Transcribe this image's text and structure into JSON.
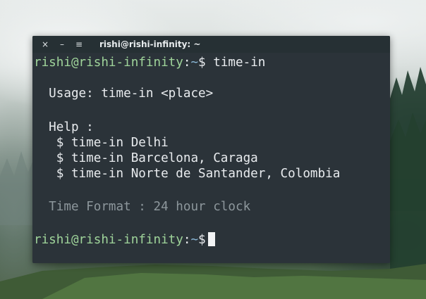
{
  "window": {
    "title": "rishi@rishi-infinity: ~",
    "buttons": {
      "close": "×",
      "minimize": "–",
      "menu": "≡"
    }
  },
  "terminal": {
    "prompt": {
      "user_host": "rishi@rishi-infinity",
      "separator": ":",
      "path": "~",
      "symbol": "$"
    },
    "command": " time-in",
    "output": [
      "  Usage: time-in <place>",
      "  Help :",
      "   $ time-in Delhi",
      "   $ time-in Barcelona, Caraga",
      "   $ time-in Norte de Santander, Colombia",
      "  Time Format : 24 hour clock"
    ]
  },
  "colors": {
    "terminal_bg": "#2b3339",
    "titlebar_bg": "#263034",
    "prompt_user": "#9fd49a",
    "prompt_path": "#8bb8d8",
    "muted_text": "#8d979c"
  }
}
